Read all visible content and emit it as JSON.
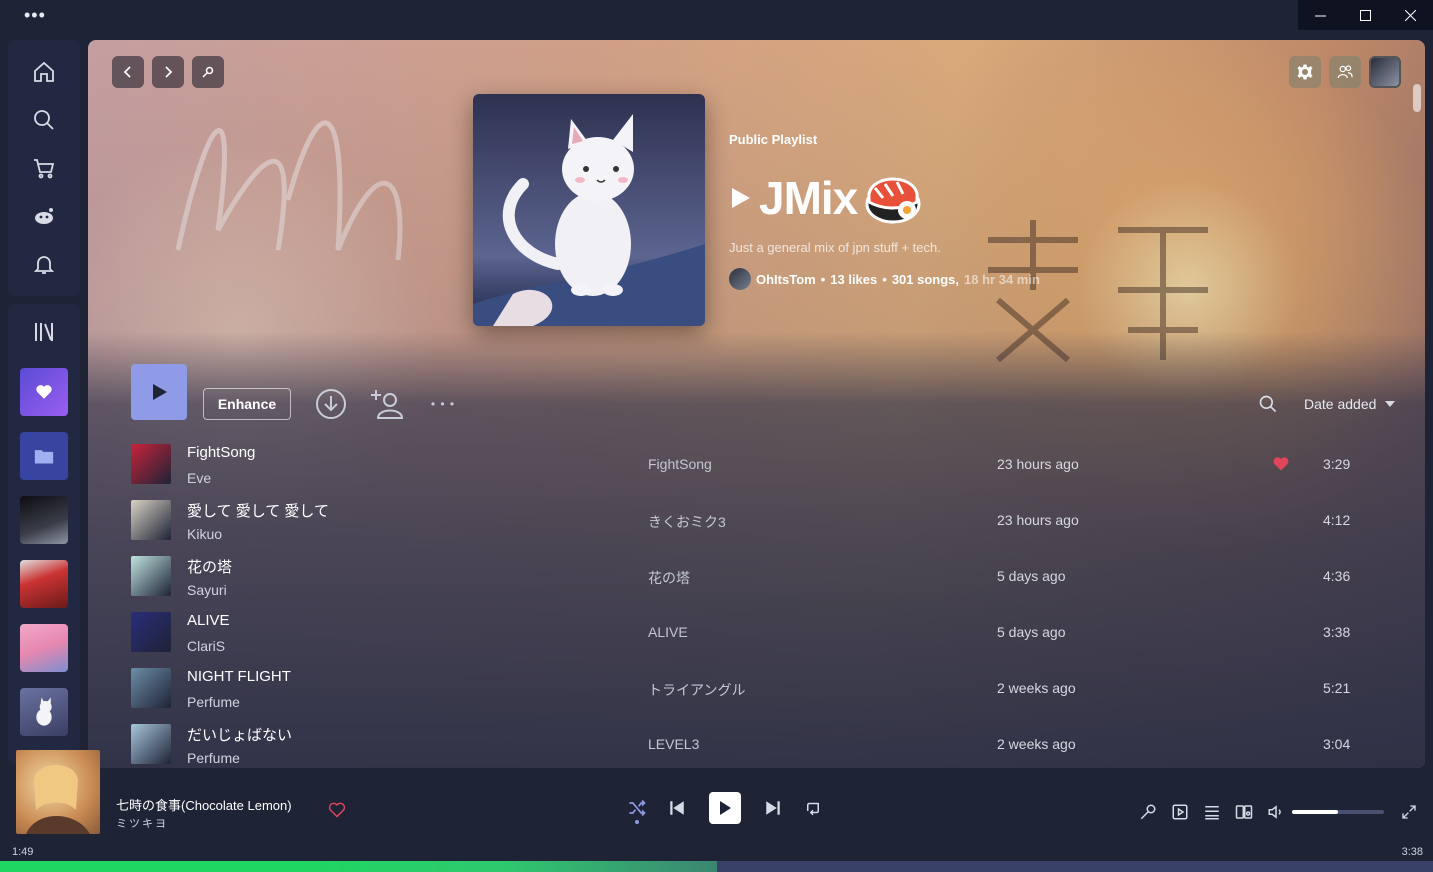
{
  "window": {
    "menu_dots": "•••",
    "minimize": "—",
    "maximize": "☐",
    "close": "✕"
  },
  "playlist": {
    "type_label": "Public Playlist",
    "title": "JMix",
    "description": "Just a general mix of jpn stuff + tech.",
    "owner": "OhItsTom",
    "likes": "13 likes",
    "songs": "301 songs,",
    "duration": "18 hr 34 min",
    "bullet": "•"
  },
  "actions": {
    "enhance_label": "Enhance",
    "more_label": "• • •",
    "sort_label": "Date added"
  },
  "tracks": [
    {
      "title": "FightSong",
      "artist": "Eve",
      "album": "FightSong",
      "added": "23 hours ago",
      "liked": true,
      "duration": "3:29",
      "thumb": "#c7233a"
    },
    {
      "title": "愛して 愛して 愛して",
      "artist": "Kikuo",
      "album": "きくおミク3",
      "added": "23 hours ago",
      "liked": false,
      "duration": "4:12",
      "thumb": "#d9d3c4"
    },
    {
      "title": "花の塔",
      "artist": "Sayuri",
      "album": "花の塔",
      "added": "5 days ago",
      "liked": false,
      "duration": "4:36",
      "thumb": "#bfe3df"
    },
    {
      "title": "ALIVE",
      "artist": "ClariS",
      "album": "ALIVE",
      "added": "5 days ago",
      "liked": false,
      "duration": "3:38",
      "thumb": "#2a2d7a"
    },
    {
      "title": "NIGHT FLIGHT",
      "artist": "Perfume",
      "album": "トライアングル",
      "added": "2 weeks ago",
      "liked": false,
      "duration": "5:21",
      "thumb": "#6d8ea8"
    },
    {
      "title": "だいじょばない",
      "artist": "Perfume",
      "album": "LEVEL3",
      "added": "2 weeks ago",
      "liked": false,
      "duration": "3:04",
      "thumb": "#a8c6dc"
    }
  ],
  "now_playing": {
    "title": "七時の食事(Chocolate Lemon)",
    "artist": "ミツキヨ",
    "elapsed": "1:49",
    "total": "3:38",
    "progress_fraction": 0.5,
    "volume_fraction": 0.5
  },
  "colors": {
    "accent": "#8f9be6",
    "liked_heart": "#e0455c",
    "progress": "#1ed760",
    "sidebar": "#232842",
    "liked_songs_tile": "#7c4ddb",
    "folder_tile": "#3845a0"
  },
  "icons": {
    "sidebar": [
      "home-icon",
      "search-icon",
      "cart-icon",
      "reddit-icon",
      "bell-icon",
      "library-icon"
    ],
    "header": [
      "back-icon",
      "forward-icon",
      "pin-icon",
      "settings-icon",
      "friends-icon",
      "avatar"
    ],
    "player": [
      "shuffle-icon",
      "previous-icon",
      "play-icon",
      "next-icon",
      "repeat-icon",
      "lyrics-icon",
      "video-icon",
      "queue-icon",
      "devices-icon",
      "volume-icon",
      "fullscreen-icon"
    ]
  }
}
